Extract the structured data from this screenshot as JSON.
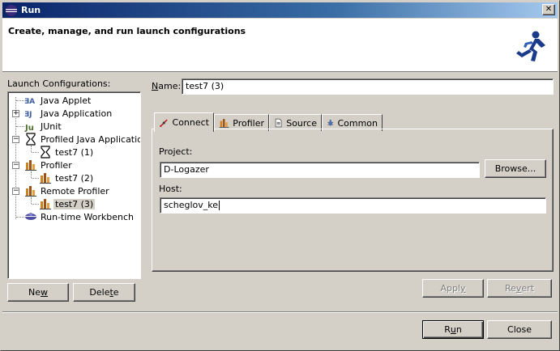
{
  "window": {
    "title": "Run",
    "close_glyph": "✕"
  },
  "banner": {
    "title": "Create, manage, and run launch configurations",
    "icon": "runner-icon"
  },
  "left": {
    "label": "Launch Configurations:",
    "tree": [
      {
        "label": "Java Applet",
        "icon": "java-applet-icon"
      },
      {
        "label": "Java Application",
        "icon": "java-application-icon",
        "expander": "+"
      },
      {
        "label": "JUnit",
        "icon": "junit-icon"
      },
      {
        "label": "Profiled Java Application",
        "icon": "hourglass-icon",
        "expander": "−"
      },
      {
        "label": "test7 (1)",
        "icon": "hourglass-icon"
      },
      {
        "label": "Profiler",
        "icon": "profiler-icon",
        "expander": "−"
      },
      {
        "label": "test7 (2)",
        "icon": "profiler-icon"
      },
      {
        "label": "Remote Profiler",
        "icon": "profiler-icon",
        "expander": "−"
      },
      {
        "label": "test7 (3)",
        "icon": "profiler-icon",
        "selected": true
      },
      {
        "label": "Run-time Workbench",
        "icon": "workbench-icon"
      }
    ],
    "new_pre": "Ne",
    "new_u": "w",
    "new_post": "",
    "delete_pre": "Dele",
    "delete_u": "t",
    "delete_post": "e"
  },
  "right": {
    "name_pre": "",
    "name_u": "N",
    "name_post": "ame:",
    "name_value": "test7 (3)",
    "tabs": [
      {
        "label": "Connect",
        "icon": "connect-icon",
        "active": true
      },
      {
        "label": "Profiler",
        "icon": "profiler-icon"
      },
      {
        "label": "Source",
        "icon": "source-icon"
      },
      {
        "label": "Common",
        "icon": "common-icon"
      }
    ],
    "project_label": "Project:",
    "project_value": "D-Logazer",
    "browse_label": "Browse...",
    "host_label": "Host:",
    "host_value": "scheglov_ke",
    "apply_pre": "Appl",
    "apply_u": "y",
    "apply_post": "",
    "revert_pre": "Re",
    "revert_u": "v",
    "revert_post": "ert"
  },
  "footer": {
    "run_pre": "R",
    "run_u": "u",
    "run_post": "n",
    "close_label": "Close"
  }
}
